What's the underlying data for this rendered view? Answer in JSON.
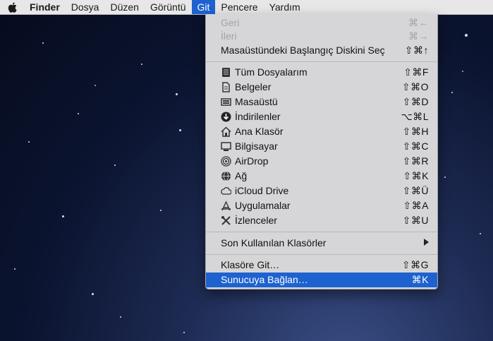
{
  "menubar": {
    "app_name": "Finder",
    "menus": [
      "Dosya",
      "Düzen",
      "Görüntü",
      "Git",
      "Pencere",
      "Yardım"
    ]
  },
  "go_menu": {
    "back": {
      "label": "Geri",
      "shortcut": "⌘←"
    },
    "forward": {
      "label": "İleri",
      "shortcut": "⌘→"
    },
    "startup_disk": {
      "label": "Masaüstündeki Başlangıç Diskini Seç",
      "shortcut": "⇧⌘↑"
    },
    "places": [
      {
        "label": "Tüm Dosyalarım",
        "shortcut": "⇧⌘F",
        "icon": "all-files-icon"
      },
      {
        "label": "Belgeler",
        "shortcut": "⇧⌘O",
        "icon": "documents-icon"
      },
      {
        "label": "Masaüstü",
        "shortcut": "⇧⌘D",
        "icon": "desktop-icon"
      },
      {
        "label": "İndirilenler",
        "shortcut": "⌥⌘L",
        "icon": "downloads-icon"
      },
      {
        "label": "Ana Klasör",
        "shortcut": "⇧⌘H",
        "icon": "home-icon"
      },
      {
        "label": "Bilgisayar",
        "shortcut": "⇧⌘C",
        "icon": "computer-icon"
      },
      {
        "label": "AirDrop",
        "shortcut": "⇧⌘R",
        "icon": "airdrop-icon"
      },
      {
        "label": "Ağ",
        "shortcut": "⇧⌘K",
        "icon": "network-icon"
      },
      {
        "label": "iCloud Drive",
        "shortcut": "⇧⌘Ü",
        "icon": "icloud-icon"
      },
      {
        "label": "Uygulamalar",
        "shortcut": "⇧⌘A",
        "icon": "applications-icon"
      },
      {
        "label": "İzlenceler",
        "shortcut": "⇧⌘U",
        "icon": "utilities-icon"
      }
    ],
    "recent_folders": {
      "label": "Son Kullanılan Klasörler"
    },
    "go_to_folder": {
      "label": "Klasöre Git…",
      "shortcut": "⇧⌘G"
    },
    "connect_server": {
      "label": "Sunucuya Bağlan…",
      "shortcut": "⌘K"
    }
  },
  "colors": {
    "accent": "#1e62d0",
    "menu_bg": "#d6d6d8",
    "desktop": "#0b1430"
  }
}
